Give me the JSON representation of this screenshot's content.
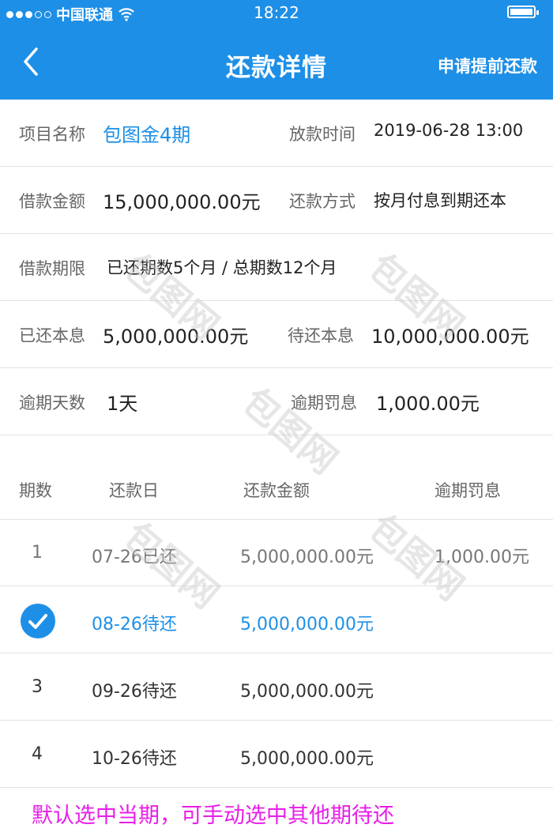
{
  "status_bar": {
    "carrier": "中国联通",
    "time": "18:22"
  },
  "nav": {
    "title": "还款详情",
    "action": "申请提前还款"
  },
  "details": {
    "project_name_label": "项目名称",
    "project_name": "包图金4期",
    "loan_time_label": "放款时间",
    "loan_time": "2019-06-28 13:00",
    "amount_label": "借款金额",
    "amount": "15,000,000.00元",
    "method_label": "还款方式",
    "method": "按月付息到期还本",
    "term_label": "借款期限",
    "term": "已还期数5个月 / 总期数12个月",
    "repaid_label": "已还本息",
    "repaid": "5,000,000.00元",
    "pending_label": "待还本息",
    "pending": "10,000,000.00元",
    "overdue_days_label": "逾期天数",
    "overdue_days": "1天",
    "penalty_label": "逾期罚息",
    "penalty": "1,000.00元"
  },
  "table": {
    "headers": {
      "period": "期数",
      "date": "还款日",
      "amount": "还款金额",
      "penalty": "逾期罚息"
    },
    "rows": [
      {
        "period": "1",
        "date": "07-26已还",
        "amount": "5,000,000.00元",
        "penalty": "1,000.00元"
      },
      {
        "period": "",
        "date": "08-26待还",
        "amount": "5,000,000.00元",
        "penalty": ""
      },
      {
        "period": "3",
        "date": "09-26待还",
        "amount": "5,000,000.00元",
        "penalty": ""
      },
      {
        "period": "4",
        "date": "10-26待还",
        "amount": "5,000,000.00元",
        "penalty": ""
      }
    ]
  },
  "note": "默认选中当期，可手动选中其他期待还",
  "watermark": "包图网",
  "colors": {
    "accent": "#1e8fe6",
    "note": "#e81ee8"
  }
}
